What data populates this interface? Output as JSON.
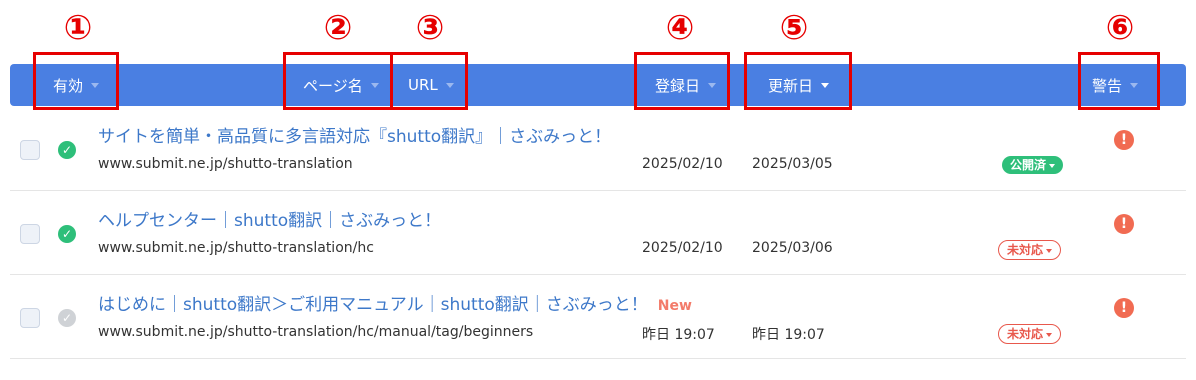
{
  "markers": [
    "①",
    "②",
    "③",
    "④",
    "⑤",
    "⑥"
  ],
  "header": {
    "col_active": "有効",
    "col_page_name": "ページ名",
    "col_url": "URL",
    "col_registered": "登録日",
    "col_updated": "更新日",
    "col_warning": "警告"
  },
  "rows": [
    {
      "status": "active",
      "title": "サイトを簡単・高品質に多言語対応『shutto翻訳』｜さぶみっと！",
      "new_label": "",
      "url": "www.submit.ne.jp/shutto-translation",
      "registered": "2025/02/10",
      "updated": "2025/03/05",
      "badge": "公開済",
      "badge_type": "published"
    },
    {
      "status": "active",
      "title": "ヘルプセンター｜shutto翻訳｜さぶみっと！",
      "new_label": "",
      "url": "www.submit.ne.jp/shutto-translation/hc",
      "registered": "2025/02/10",
      "updated": "2025/03/06",
      "badge": "未対応",
      "badge_type": "pending"
    },
    {
      "status": "inactive",
      "title": "はじめに｜shutto翻訳＞ご利用マニュアル｜shutto翻訳｜さぶみっと！",
      "new_label": "New",
      "url": "www.submit.ne.jp/shutto-translation/hc/manual/tag/beginners",
      "registered": "昨日 19:07",
      "updated": "昨日 19:07",
      "badge": "未対応",
      "badge_type": "pending"
    }
  ],
  "colors": {
    "header": "#4a7fe2",
    "marker_red": "#e60000",
    "link": "#3d78c9",
    "published": "#2ebf7a",
    "pending": "#e8584c",
    "warning": "#f16b52"
  }
}
